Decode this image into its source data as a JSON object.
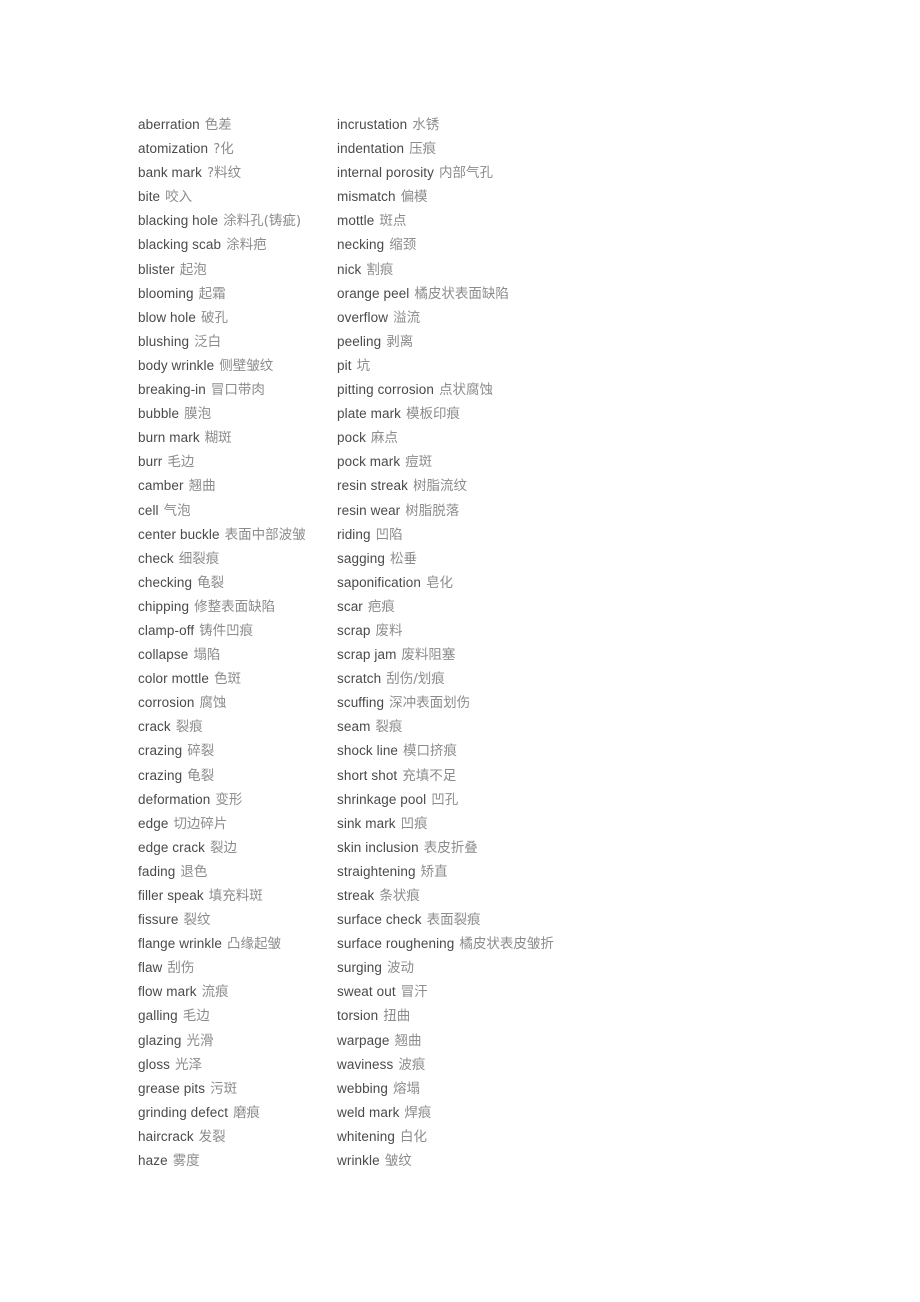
{
  "document": {
    "type": "bilingual-glossary",
    "background_color": "#ffffff",
    "english_text_color": "#4a4a4a",
    "chinese_text_color": "#8c8c8c"
  },
  "columns": [
    {
      "name": "left-column",
      "entries": [
        {
          "en": "aberration",
          "zh": "色差"
        },
        {
          "en": "atomization",
          "zh": "?化"
        },
        {
          "en": "bank mark",
          "zh": "?料纹"
        },
        {
          "en": "bite",
          "zh": "咬入"
        },
        {
          "en": "blacking hole",
          "zh": "涂料孔(铸疵)"
        },
        {
          "en": "blacking scab",
          "zh": "涂料疤"
        },
        {
          "en": "blister",
          "zh": "起泡"
        },
        {
          "en": "blooming",
          "zh": "起霜"
        },
        {
          "en": "blow hole",
          "zh": "破孔"
        },
        {
          "en": "blushing",
          "zh": "泛白"
        },
        {
          "en": "body wrinkle",
          "zh": "侧壁皱纹"
        },
        {
          "en": "breaking-in",
          "zh": "冒口带肉"
        },
        {
          "en": "bubble",
          "zh": "膜泡"
        },
        {
          "en": "burn mark",
          "zh": "糊斑"
        },
        {
          "en": "burr",
          "zh": "毛边"
        },
        {
          "en": "camber",
          "zh": "翘曲"
        },
        {
          "en": "cell",
          "zh": "气泡"
        },
        {
          "en": "center buckle",
          "zh": "表面中部波皱"
        },
        {
          "en": "check",
          "zh": "细裂痕"
        },
        {
          "en": "checking",
          "zh": "龟裂"
        },
        {
          "en": "chipping",
          "zh": "修整表面缺陷"
        },
        {
          "en": "clamp-off",
          "zh": "铸件凹痕"
        },
        {
          "en": "collapse",
          "zh": "塌陷"
        },
        {
          "en": "color mottle",
          "zh": "色斑"
        },
        {
          "en": "corrosion",
          "zh": "腐蚀"
        },
        {
          "en": "crack",
          "zh": "裂痕"
        },
        {
          "en": "crazing",
          "zh": "碎裂"
        },
        {
          "en": "crazing",
          "zh": "龟裂"
        },
        {
          "en": "deformation",
          "zh": "变形"
        },
        {
          "en": "edge",
          "zh": "切边碎片"
        },
        {
          "en": "edge crack",
          "zh": "裂边"
        },
        {
          "en": "fading",
          "zh": "退色"
        },
        {
          "en": "filler speak",
          "zh": "填充料斑"
        },
        {
          "en": "fissure",
          "zh": "裂纹"
        },
        {
          "en": "flange wrinkle",
          "zh": "凸缘起皱"
        },
        {
          "en": "flaw",
          "zh": "刮伤"
        },
        {
          "en": "flow mark",
          "zh": "流痕"
        },
        {
          "en": "galling",
          "zh": "毛边"
        },
        {
          "en": "glazing",
          "zh": "光滑"
        },
        {
          "en": "gloss",
          "zh": "光泽"
        },
        {
          "en": "grease pits",
          "zh": "污斑"
        },
        {
          "en": "grinding defect",
          "zh": "磨痕"
        },
        {
          "en": "haircrack",
          "zh": "发裂"
        },
        {
          "en": "haze",
          "zh": "雾度"
        }
      ]
    },
    {
      "name": "right-column",
      "entries": [
        {
          "en": "incrustation",
          "zh": "水锈"
        },
        {
          "en": "indentation",
          "zh": "压痕"
        },
        {
          "en": "internal porosity",
          "zh": "内部气孔"
        },
        {
          "en": "mismatch",
          "zh": "偏模"
        },
        {
          "en": "mottle",
          "zh": "斑点"
        },
        {
          "en": "necking",
          "zh": "缩颈"
        },
        {
          "en": "nick",
          "zh": "割痕"
        },
        {
          "en": "orange peel",
          "zh": "橘皮状表面缺陷"
        },
        {
          "en": "overflow",
          "zh": "溢流"
        },
        {
          "en": "peeling",
          "zh": "剥离"
        },
        {
          "en": "pit",
          "zh": "坑"
        },
        {
          "en": "pitting corrosion",
          "zh": "点状腐蚀"
        },
        {
          "en": "plate mark",
          "zh": "模板印痕"
        },
        {
          "en": "pock",
          "zh": "麻点"
        },
        {
          "en": "pock mark",
          "zh": "痘斑"
        },
        {
          "en": "resin streak",
          "zh": "树脂流纹"
        },
        {
          "en": "resin wear",
          "zh": "树脂脱落"
        },
        {
          "en": "riding",
          "zh": "凹陷"
        },
        {
          "en": "sagging",
          "zh": "松垂"
        },
        {
          "en": "saponification",
          "zh": "皂化"
        },
        {
          "en": "scar",
          "zh": "疤痕"
        },
        {
          "en": "scrap",
          "zh": "废料"
        },
        {
          "en": "scrap jam",
          "zh": "废料阻塞"
        },
        {
          "en": "scratch",
          "zh": "刮伤/划痕"
        },
        {
          "en": "scuffing",
          "zh": "深冲表面划伤"
        },
        {
          "en": "seam",
          "zh": "裂痕"
        },
        {
          "en": "shock line",
          "zh": "模口挤痕"
        },
        {
          "en": "short shot",
          "zh": "充填不足"
        },
        {
          "en": "shrinkage pool",
          "zh": "凹孔"
        },
        {
          "en": "sink mark",
          "zh": "凹痕"
        },
        {
          "en": "skin inclusion",
          "zh": "表皮折叠"
        },
        {
          "en": "straightening",
          "zh": "矫直"
        },
        {
          "en": "streak",
          "zh": "条状痕"
        },
        {
          "en": "surface check",
          "zh": "表面裂痕"
        },
        {
          "en": "surface roughening",
          "zh": "橘皮状表皮皱折"
        },
        {
          "en": "surging",
          "zh": "波动"
        },
        {
          "en": "sweat out",
          "zh": "冒汗"
        },
        {
          "en": "torsion",
          "zh": "扭曲"
        },
        {
          "en": "warpage",
          "zh": "翘曲"
        },
        {
          "en": "waviness",
          "zh": "波痕"
        },
        {
          "en": "webbing",
          "zh": "熔塌"
        },
        {
          "en": "weld mark",
          "zh": "焊痕"
        },
        {
          "en": "whitening",
          "zh": "白化"
        },
        {
          "en": "wrinkle",
          "zh": "皱纹"
        }
      ]
    }
  ]
}
